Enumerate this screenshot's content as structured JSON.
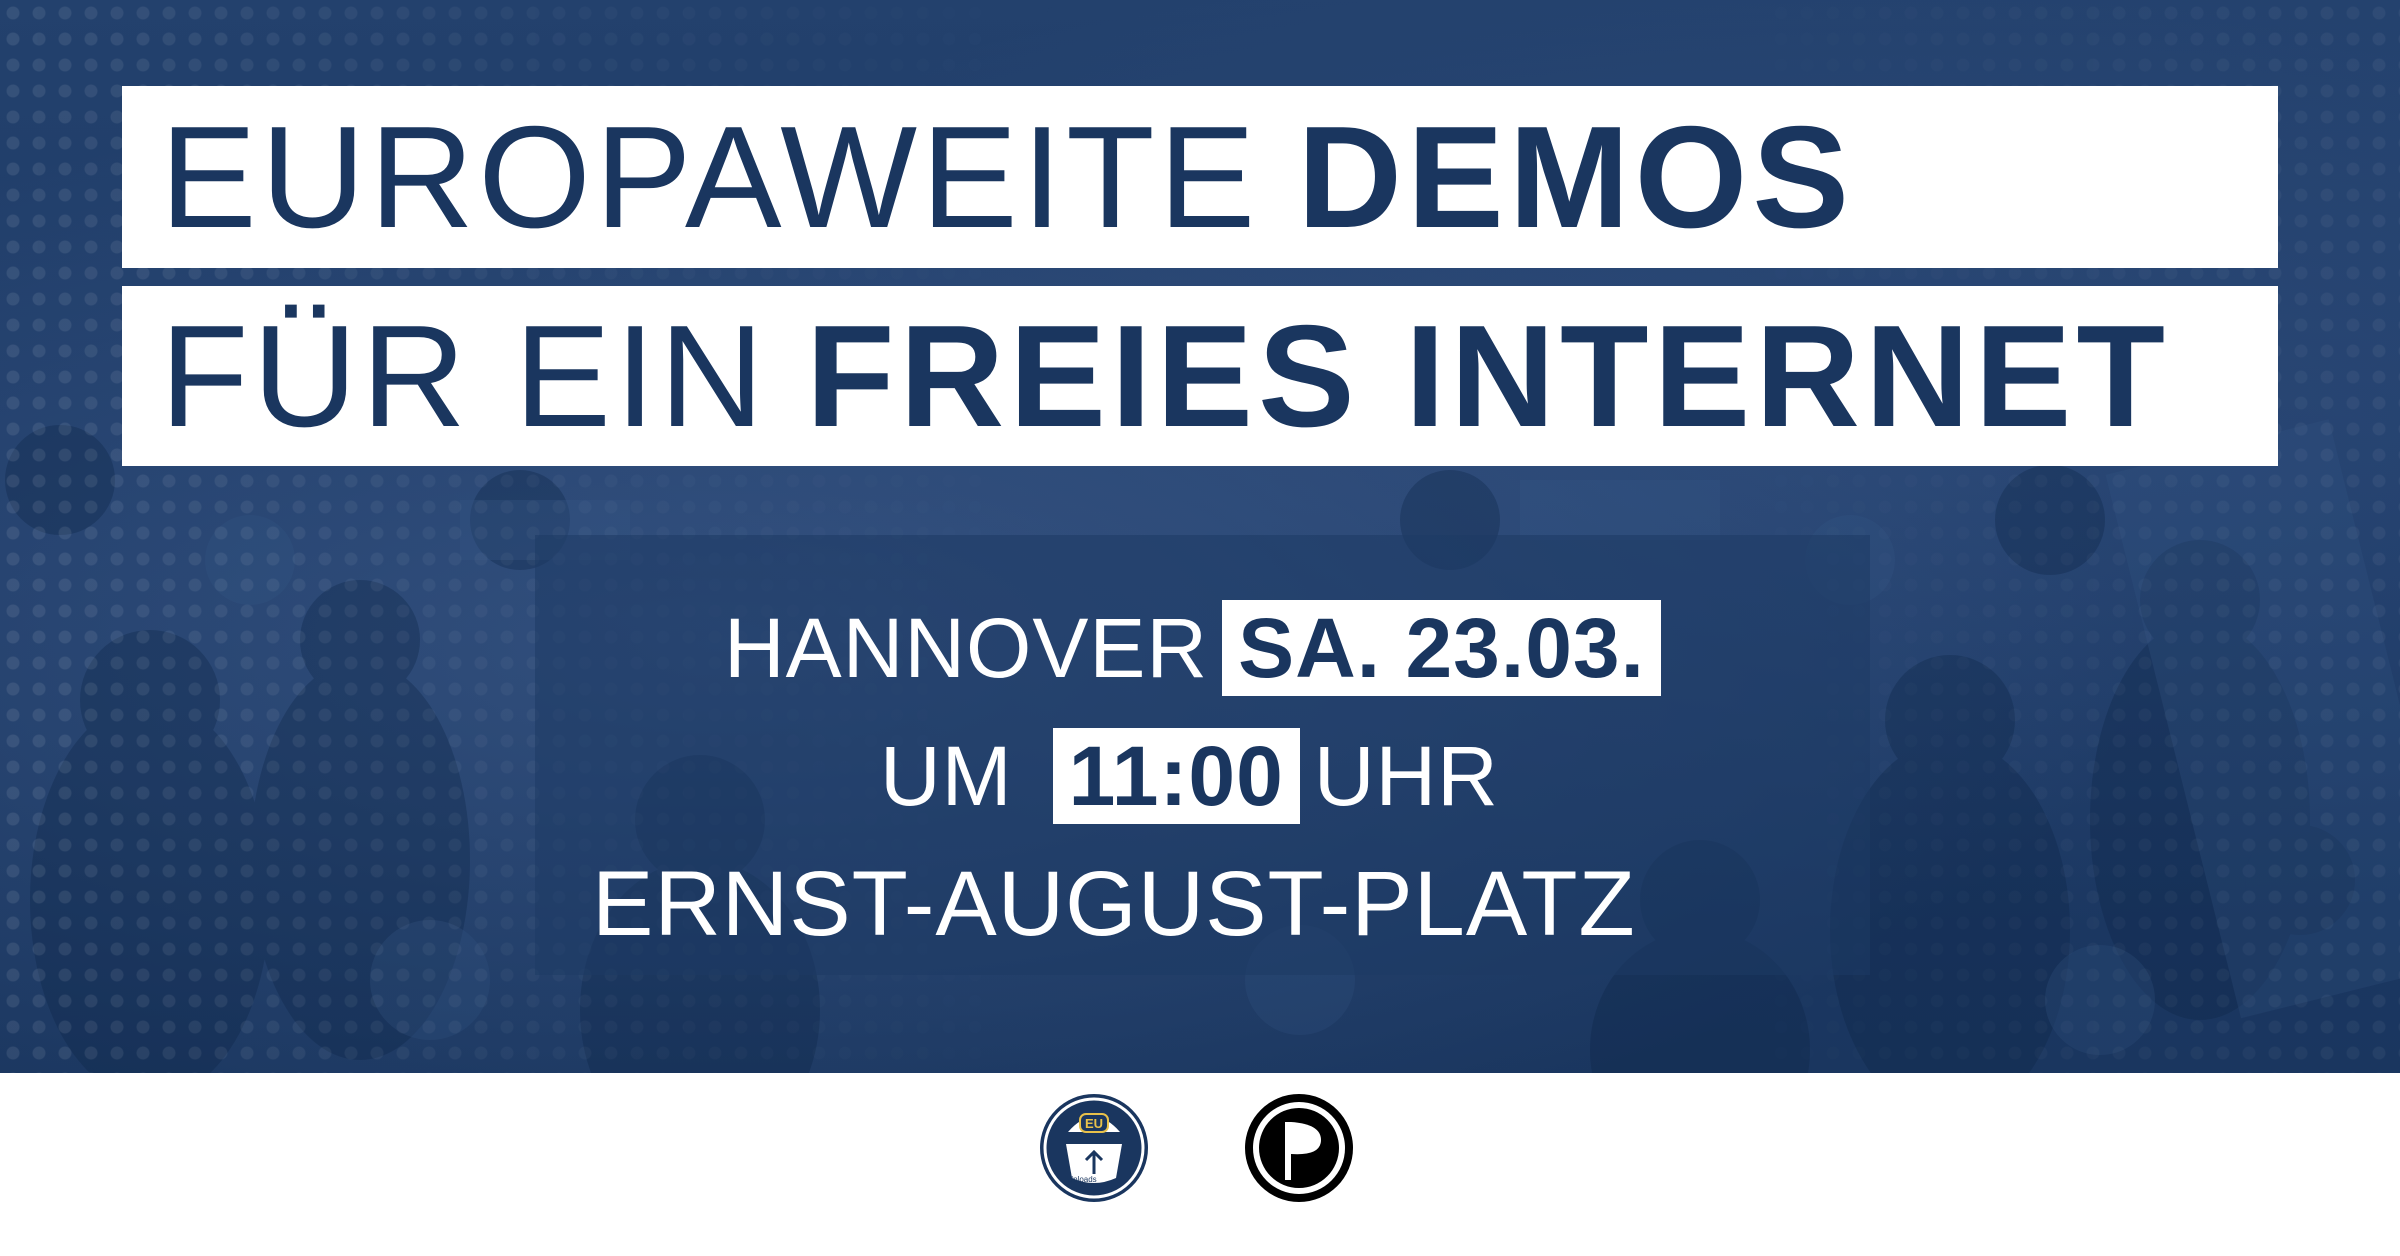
{
  "headline": {
    "line1_light": "EUROPAWEITE",
    "line1_bold": "DEMOS",
    "line2_light": "FÜR EIN",
    "line2_bold": "FREIES INTERNET"
  },
  "event": {
    "city": "HANNOVER",
    "date": "SA. 23.03.",
    "time_prefix": "UM",
    "time": "11:00",
    "time_suffix": "UHR",
    "location": "ERNST-AUGUST-PLATZ"
  },
  "logos": {
    "eu_logo_text": "EU",
    "eu_logo_subtext": "Uploads",
    "pirate_logo_icon": "pirate-flag-icon"
  },
  "colors": {
    "navy": "#1a365f",
    "white": "#ffffff"
  }
}
